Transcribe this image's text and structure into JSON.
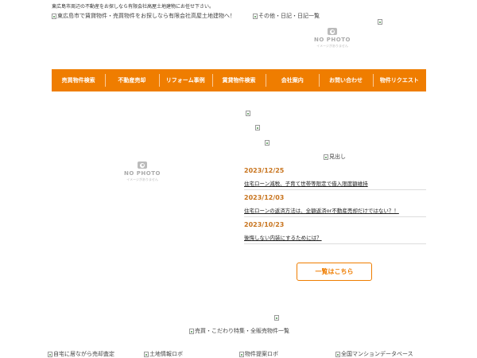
{
  "header": {
    "tagline": "東広島市周辺の不動産をお探しなら有限会社高屋土地建物にお任せ下さい。",
    "logo_alt": "東広島市で賃貸物件・売買物件をお探しなら有限会社高屋土地建物へ！",
    "blog_link_alt": "その他・日記・日記一覧"
  },
  "no_photo": {
    "title": "NO PHOTO",
    "subtitle": "イメージがありません"
  },
  "nav": {
    "items": [
      "売買物件検索",
      "不動産売却",
      "リフォーム事例",
      "賃貸物件検索",
      "会社案内",
      "お問い合わせ",
      "物件リクエスト"
    ]
  },
  "news": {
    "heading_alt": "見出し",
    "items": [
      {
        "date": "2023/12/25",
        "title": "住宅ローン減税、子育て世帯等限定で借入限度額維持"
      },
      {
        "date": "2023/12/03",
        "title": "住宅ローンの返済方法は、全額返済or不動産売却だけではない？！"
      },
      {
        "date": "2023/10/23",
        "title": "後悔しない内装にするためには？"
      }
    ],
    "more_label": "一覧はこちら"
  },
  "feature_alt": "売買・こだわり特集・全販売物件一覧",
  "bottom_links": [
    "自宅に居ながら売却査定",
    "土地情報ロボ",
    "物件提案ロボ",
    "全国マンションデータベース"
  ],
  "colors": {
    "accent": "#ef7d00",
    "date": "#c8741e"
  }
}
